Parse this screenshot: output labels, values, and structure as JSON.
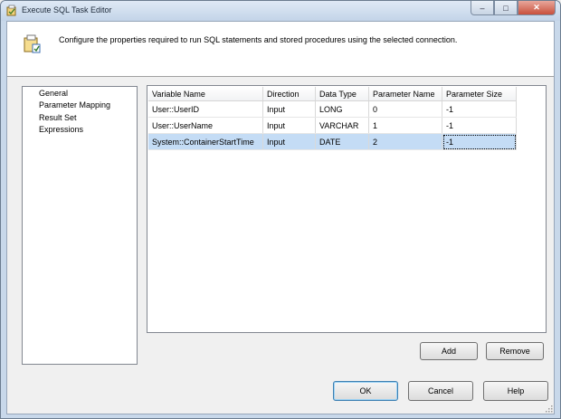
{
  "window": {
    "title": "Execute SQL Task Editor",
    "minimize_glyph": "–",
    "maximize_glyph": "□",
    "close_glyph": "✕"
  },
  "header": {
    "description": "Configure the properties required to run SQL statements and stored procedures using the selected connection.",
    "icon": "task-settings-icon"
  },
  "nav": {
    "items": [
      {
        "label": "General"
      },
      {
        "label": "Parameter Mapping"
      },
      {
        "label": "Result Set"
      },
      {
        "label": "Expressions"
      }
    ],
    "selected": "Parameter Mapping"
  },
  "grid": {
    "columns": [
      "Variable Name",
      "Direction",
      "Data Type",
      "Parameter Name",
      "Parameter Size"
    ],
    "rows": [
      {
        "variable": "User::UserID",
        "direction": "Input",
        "data_type": "LONG",
        "param_name": "0",
        "param_size": "-1"
      },
      {
        "variable": "User::UserName",
        "direction": "Input",
        "data_type": "VARCHAR",
        "param_name": "1",
        "param_size": "-1"
      },
      {
        "variable": "System::ContainerStartTime",
        "direction": "Input",
        "data_type": "DATE",
        "param_name": "2",
        "param_size": "-1"
      }
    ],
    "selected_row": 2
  },
  "buttons": {
    "add": "Add",
    "remove": "Remove",
    "ok": "OK",
    "cancel": "Cancel",
    "help": "Help"
  },
  "colors": {
    "selection": "#c4dcf5",
    "title_bar": "#c3d4e8",
    "close_button": "#c9503c"
  }
}
